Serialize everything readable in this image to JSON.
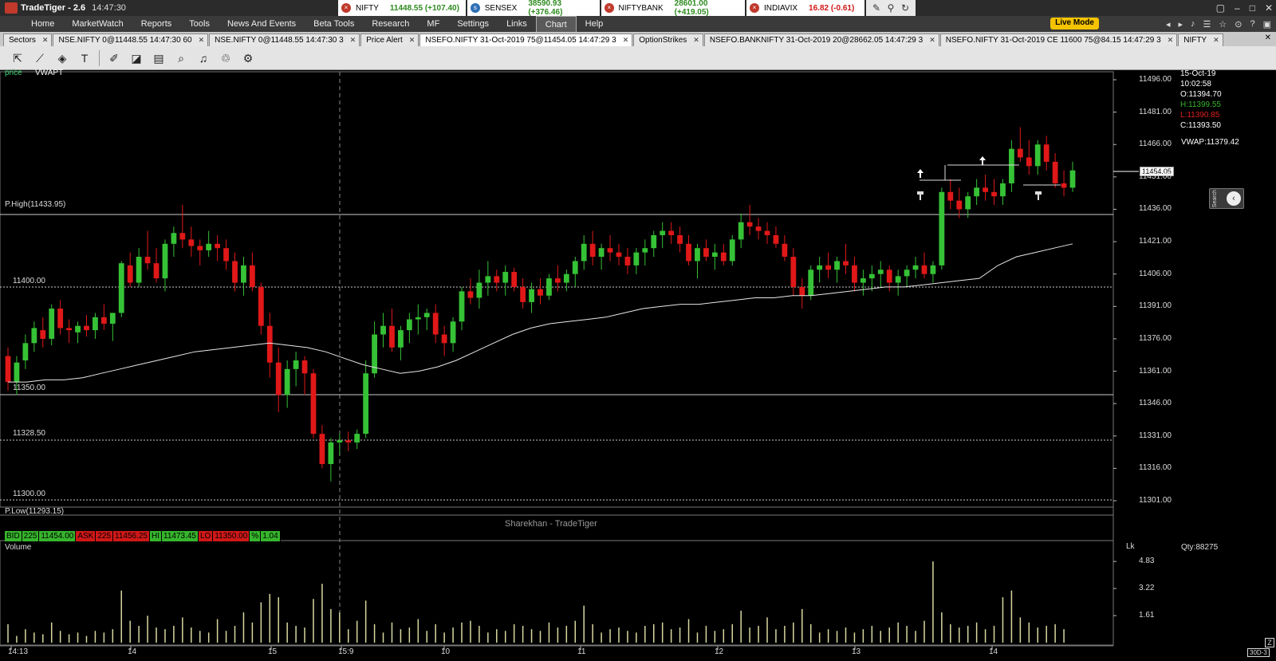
{
  "titlebar": {
    "title": "TradeTiger - 2.6",
    "time": "14:47:30"
  },
  "ticker": [
    {
      "symbol": "NIFTY",
      "value": "11448.55 (+107.40)"
    },
    {
      "symbol": "SENSEX",
      "value": "38590.93 (+376.46)"
    },
    {
      "symbol": "NIFTYBANK",
      "value": "28601.00 (+419.05)"
    },
    {
      "symbol": "INDIAVIX",
      "value": "16.82 (-0.61)"
    }
  ],
  "menu": {
    "items": [
      "Home",
      "MarketWatch",
      "Reports",
      "Tools",
      "News And Events",
      "Beta Tools",
      "Research",
      "MF",
      "Settings",
      "Links",
      "Chart",
      "Help"
    ],
    "active": "Chart",
    "live_mode": "Live Mode"
  },
  "tabs": [
    "Sectors",
    "NSE.NIFTY 0@11448.55 14:47:30 60",
    "NSE.NIFTY 0@11448.55 14:47:30 3",
    "Price Alert",
    "NSEFO.NIFTY 31-Oct-2019 75@11454.05 14:47:29 3",
    "OptionStrikes",
    "NSEFO.BANKNIFTY 31-Oct-2019 20@28662.05 14:47:29 3",
    "NSEFO.NIFTY 31-Oct-2019 CE 11600 75@84.15 14:47:29 3",
    "NIFTY"
  ],
  "active_tab": 4,
  "chart": {
    "labels": {
      "price": "price",
      "vwapt": "VWAPT",
      "phigh": "P.High(11433.95)",
      "plow": "P.Low(11293.15)",
      "watermark": "Sharekhan - TradeTiger",
      "volume": "Volume",
      "qty": "Qty:88275",
      "lk": "Lk"
    },
    "levels": [
      "11400.00",
      "11350.00",
      "11328.50",
      "11300.00"
    ],
    "info": {
      "date": "15-Oct-19",
      "time": "10:02:58",
      "open": "O:11394.70",
      "high": "H:11399.55",
      "low": "L:11390.85",
      "close": "C:11393.50",
      "vwap": "VWAP:11379.42"
    },
    "current_price": "11454.05",
    "price_axis": [
      "11496.00",
      "11481.00",
      "11466.00",
      "11451.00",
      "11436.00",
      "11421.00",
      "11406.00",
      "11391.00",
      "11376.00",
      "11361.00",
      "11346.00",
      "11331.00",
      "11316.00",
      "11301.00"
    ],
    "volume_axis": [
      "4.83",
      "3.22",
      "1.61"
    ],
    "time_axis": [
      "14:13",
      "14",
      "15",
      "15:9",
      "10",
      "11",
      "12",
      "13",
      "14"
    ],
    "bidbar": [
      {
        "t": "BID",
        "c": "g"
      },
      {
        "t": "225",
        "c": "g"
      },
      {
        "t": "11454.00",
        "c": "g"
      },
      {
        "t": "ASK",
        "c": "r"
      },
      {
        "t": "225",
        "c": "r"
      },
      {
        "t": "11456.25",
        "c": "r"
      },
      {
        "t": "HI",
        "c": "g"
      },
      {
        "t": "11473.45",
        "c": "g"
      },
      {
        "t": "LO",
        "c": "r"
      },
      {
        "t": "11350.00",
        "c": "r"
      },
      {
        "t": "%",
        "c": "g"
      },
      {
        "t": "1.04",
        "c": "g"
      }
    ],
    "period": "30D-3",
    "side_search": "Search"
  },
  "chart_data": {
    "type": "candlestick",
    "candles": [
      [
        11368,
        11372,
        11352,
        11356
      ],
      [
        11356,
        11368,
        11350,
        11365
      ],
      [
        11366,
        11378,
        11362,
        11374
      ],
      [
        11374,
        11384,
        11370,
        11381
      ],
      [
        11380,
        11386,
        11372,
        11376
      ],
      [
        11376,
        11392,
        11373,
        11390
      ],
      [
        11390,
        11394,
        11378,
        11381
      ],
      [
        11381,
        11385,
        11374,
        11380
      ],
      [
        11379,
        11384,
        11374,
        11382
      ],
      [
        11382,
        11387,
        11377,
        11380
      ],
      [
        11380,
        11388,
        11376,
        11386
      ],
      [
        11386,
        11392,
        11380,
        11383
      ],
      [
        11383,
        11388,
        11375,
        11388
      ],
      [
        11388,
        11412,
        11386,
        11411
      ],
      [
        11410,
        11416,
        11400,
        11402
      ],
      [
        11402,
        11418,
        11400,
        11414
      ],
      [
        11414,
        11426,
        11408,
        11411
      ],
      [
        11411,
        11418,
        11402,
        11404
      ],
      [
        11404,
        11422,
        11398,
        11420
      ],
      [
        11420,
        11428,
        11414,
        11425
      ],
      [
        11425,
        11438,
        11418,
        11422
      ],
      [
        11422,
        11428,
        11414,
        11419
      ],
      [
        11419,
        11422,
        11410,
        11417
      ],
      [
        11417,
        11426,
        11414,
        11420
      ],
      [
        11420,
        11424,
        11412,
        11418
      ],
      [
        11418,
        11422,
        11408,
        11412
      ],
      [
        11412,
        11416,
        11398,
        11402
      ],
      [
        11402,
        11414,
        11396,
        11410
      ],
      [
        11410,
        11416,
        11398,
        11400
      ],
      [
        11400,
        11402,
        11378,
        11382
      ],
      [
        11382,
        11388,
        11358,
        11365
      ],
      [
        11365,
        11372,
        11342,
        11350
      ],
      [
        11350,
        11366,
        11344,
        11362
      ],
      [
        11362,
        11370,
        11354,
        11366
      ],
      [
        11366,
        11368,
        11350,
        11360
      ],
      [
        11360,
        11362,
        11330,
        11332
      ],
      [
        11332,
        11336,
        11316,
        11318
      ],
      [
        11318,
        11330,
        11310,
        11328
      ],
      [
        11328,
        11332,
        11322,
        11329
      ],
      [
        11329,
        11333,
        11324,
        11328
      ],
      [
        11328,
        11334,
        11325,
        11332
      ],
      [
        11332,
        11366,
        11330,
        11360
      ],
      [
        11360,
        11384,
        11358,
        11378
      ],
      [
        11378,
        11388,
        11372,
        11382
      ],
      [
        11382,
        11390,
        11370,
        11372
      ],
      [
        11372,
        11382,
        11366,
        11380
      ],
      [
        11380,
        11388,
        11374,
        11385
      ],
      [
        11385,
        11392,
        11378,
        11386
      ],
      [
        11386,
        11390,
        11380,
        11388
      ],
      [
        11388,
        11392,
        11374,
        11378
      ],
      [
        11378,
        11382,
        11368,
        11374
      ],
      [
        11374,
        11386,
        11370,
        11384
      ],
      [
        11384,
        11400,
        11380,
        11398
      ],
      [
        11398,
        11404,
        11392,
        11395
      ],
      [
        11395,
        11408,
        11390,
        11402
      ],
      [
        11402,
        11412,
        11396,
        11405
      ],
      [
        11405,
        11408,
        11398,
        11402
      ],
      [
        11402,
        11410,
        11396,
        11407
      ],
      [
        11407,
        11409,
        11398,
        11400
      ],
      [
        11400,
        11404,
        11390,
        11393
      ],
      [
        11393,
        11402,
        11388,
        11399
      ],
      [
        11399,
        11404,
        11392,
        11396
      ],
      [
        11396,
        11406,
        11394,
        11404
      ],
      [
        11404,
        11410,
        11398,
        11402
      ],
      [
        11402,
        11408,
        11398,
        11406
      ],
      [
        11406,
        11414,
        11400,
        11412
      ],
      [
        11412,
        11424,
        11408,
        11420
      ],
      [
        11420,
        11426,
        11410,
        11414
      ],
      [
        11414,
        11420,
        11408,
        11418
      ],
      [
        11418,
        11424,
        11412,
        11416
      ],
      [
        11416,
        11420,
        11410,
        11414
      ],
      [
        11414,
        11418,
        11406,
        11410
      ],
      [
        11410,
        11418,
        11406,
        11416
      ],
      [
        11416,
        11422,
        11410,
        11418
      ],
      [
        11418,
        11426,
        11414,
        11424
      ],
      [
        11424,
        11430,
        11418,
        11426
      ],
      [
        11426,
        11430,
        11420,
        11424
      ],
      [
        11424,
        11428,
        11416,
        11420
      ],
      [
        11420,
        11424,
        11410,
        11412
      ],
      [
        11412,
        11420,
        11404,
        11418
      ],
      [
        11418,
        11422,
        11412,
        11414
      ],
      [
        11414,
        11420,
        11408,
        11416
      ],
      [
        11416,
        11420,
        11410,
        11412
      ],
      [
        11412,
        11424,
        11410,
        11422
      ],
      [
        11422,
        11434,
        11418,
        11430
      ],
      [
        11430,
        11438,
        11424,
        11428
      ],
      [
        11428,
        11432,
        11422,
        11426
      ],
      [
        11426,
        11430,
        11420,
        11424
      ],
      [
        11424,
        11428,
        11418,
        11420
      ],
      [
        11420,
        11424,
        11412,
        11414
      ],
      [
        11414,
        11418,
        11396,
        11400
      ],
      [
        11400,
        11404,
        11390,
        11396
      ],
      [
        11396,
        11410,
        11394,
        11408
      ],
      [
        11408,
        11414,
        11402,
        11410
      ],
      [
        11410,
        11416,
        11404,
        11408
      ],
      [
        11408,
        11414,
        11402,
        11412
      ],
      [
        11412,
        11420,
        11406,
        11410
      ],
      [
        11410,
        11414,
        11398,
        11402
      ],
      [
        11402,
        11408,
        11396,
        11404
      ],
      [
        11404,
        11410,
        11398,
        11406
      ],
      [
        11406,
        11412,
        11400,
        11408
      ],
      [
        11408,
        11410,
        11398,
        11402
      ],
      [
        11402,
        11408,
        11396,
        11405
      ],
      [
        11405,
        11410,
        11400,
        11408
      ],
      [
        11408,
        11414,
        11404,
        11410
      ],
      [
        11410,
        11416,
        11404,
        11406
      ],
      [
        11406,
        11412,
        11402,
        11410
      ],
      [
        11410,
        11446,
        11408,
        11444
      ],
      [
        11444,
        11450,
        11436,
        11440
      ],
      [
        11440,
        11446,
        11432,
        11436
      ],
      [
        11436,
        11444,
        11432,
        11442
      ],
      [
        11442,
        11450,
        11438,
        11446
      ],
      [
        11446,
        11452,
        11440,
        11444
      ],
      [
        11444,
        11450,
        11438,
        11442
      ],
      [
        11442,
        11450,
        11438,
        11448
      ],
      [
        11448,
        11468,
        11444,
        11464
      ],
      [
        11464,
        11474,
        11458,
        11460
      ],
      [
        11460,
        11468,
        11452,
        11456
      ],
      [
        11456,
        11468,
        11452,
        11466
      ],
      [
        11466,
        11470,
        11454,
        11458
      ],
      [
        11458,
        11462,
        11446,
        11448
      ],
      [
        11448,
        11454,
        11442,
        11446
      ],
      [
        11446,
        11458,
        11444,
        11454
      ]
    ],
    "price_range": [
      11301,
      11496
    ],
    "volume": [
      1.1,
      0.4,
      0.8,
      0.6,
      0.5,
      1.2,
      0.7,
      0.5,
      0.6,
      0.4,
      0.7,
      0.6,
      0.8,
      3.1,
      1.3,
      1.0,
      1.6,
      0.9,
      0.8,
      1.0,
      1.5,
      0.9,
      0.7,
      0.6,
      1.4,
      0.7,
      1.0,
      1.8,
      1.2,
      2.4,
      2.9,
      2.7,
      1.2,
      1.0,
      0.9,
      2.6,
      3.5,
      2.0,
      1.8,
      0.8,
      1.3,
      2.5,
      1.1,
      0.6,
      1.2,
      0.8,
      0.9,
      1.4,
      0.7,
      1.1,
      0.6,
      0.9,
      1.2,
      1.3,
      1.0,
      0.6,
      0.8,
      0.7,
      1.1,
      1.0,
      0.8,
      0.7,
      1.2,
      0.9,
      1.0,
      1.3,
      2.2,
      1.1,
      0.6,
      0.8,
      0.9,
      0.7,
      0.6,
      1.0,
      1.1,
      1.2,
      0.8,
      0.9,
      1.4,
      0.6,
      1.0,
      0.7,
      0.8,
      1.1,
      1.9,
      0.9,
      1.0,
      1.5,
      0.8,
      1.0,
      1.2,
      2.0,
      1.1,
      0.6,
      0.8,
      0.7,
      0.9,
      0.6,
      0.8,
      1.0,
      0.7,
      0.9,
      1.2,
      1.0,
      0.7,
      1.3,
      4.83,
      1.8,
      1.1,
      0.9,
      1.0,
      1.2,
      0.8,
      1.0,
      2.7,
      3.1,
      1.5,
      1.2,
      0.9,
      1.0,
      1.1,
      0.8
    ],
    "volume_range": [
      0,
      5.5
    ],
    "vwap": [
      11356,
      11356,
      11357,
      11357,
      11358,
      11360,
      11362,
      11364,
      11366,
      11368,
      11370,
      11371,
      11372,
      11373,
      11374,
      11373,
      11372,
      11370,
      11367,
      11364,
      11362,
      11360,
      11361,
      11363,
      11366,
      11370,
      11374,
      11378,
      11381,
      11383,
      11384,
      11385,
      11386,
      11388,
      11390,
      11391,
      11392,
      11392,
      11393,
      11394,
      11395,
      11395,
      11396,
      11396,
      11397,
      11398,
      11399,
      11400,
      11400,
      11401,
      11402,
      11403,
      11404,
      11410,
      11414,
      11416,
      11418,
      11420
    ],
    "hlines": [
      11433.95,
      11400,
      11350,
      11328.5,
      11300,
      11293.15
    ]
  }
}
